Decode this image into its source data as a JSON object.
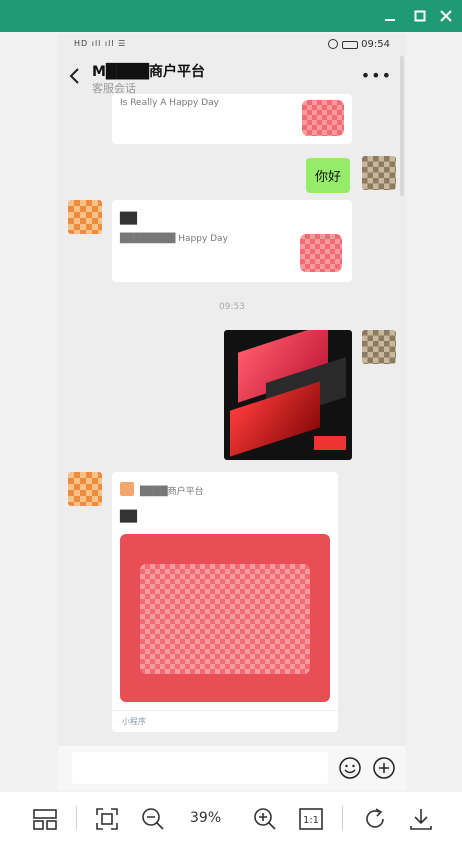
{
  "window": {
    "accent": "#1e9b73"
  },
  "status_bar": {
    "left_text": "HD ıll ıll ☰",
    "time": "09:54"
  },
  "chat": {
    "title": "M████商户平台",
    "subtitle": "客服会话",
    "more_label": "•••"
  },
  "messages": {
    "card1_text": "Is Really A Happy Day",
    "greeting": "你好",
    "card2_title": "██",
    "card2_text": "████████ Happy Day",
    "timestamp": "09:53",
    "mini_source": "████商户平台",
    "mini_title": "██",
    "mini_footer": "小程序"
  },
  "viewer": {
    "zoom": "39%",
    "ratio_label": "1:1"
  },
  "icons": [
    "minimize-icon",
    "maximize-icon",
    "close-icon",
    "back-icon",
    "more-icon",
    "emoji-icon",
    "add-icon",
    "thumbnail-icon",
    "fit-icon",
    "zoom-out-icon",
    "zoom-in-icon",
    "actual-size-icon",
    "rotate-icon",
    "download-icon"
  ]
}
